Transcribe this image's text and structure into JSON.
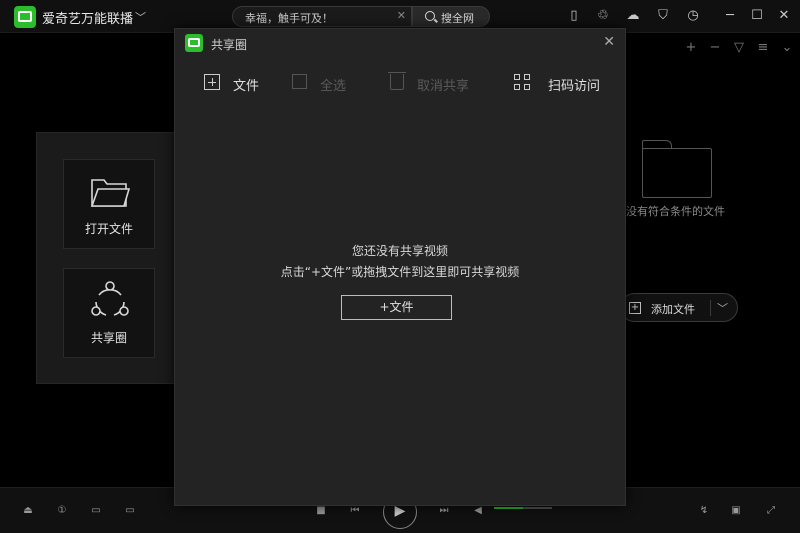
{
  "app": {
    "title": "爱奇艺万能联播"
  },
  "search": {
    "value": "幸福，触手可及！",
    "button": "搜全网"
  },
  "background": {
    "empty_text": "没有符合条件的文件",
    "add_file": "添加文件",
    "tiles": [
      {
        "label": "打开文件"
      },
      {
        "label": "共享圈"
      }
    ]
  },
  "dialog": {
    "title": "共享圈",
    "tools": {
      "add_file": "文件",
      "select_all": "全选",
      "cancel_share": "取消共享",
      "scan_access": "扫码访问"
    },
    "message_line1": "您还没有共享视频",
    "message_line2": "点击“+文件”或拖拽文件到这里即可共享视频",
    "add_button": "+文件"
  },
  "player": {
    "volume": 0.5
  },
  "colors": {
    "accent": "#2bbd2b",
    "background": "#000000",
    "dialog": "#232323"
  }
}
